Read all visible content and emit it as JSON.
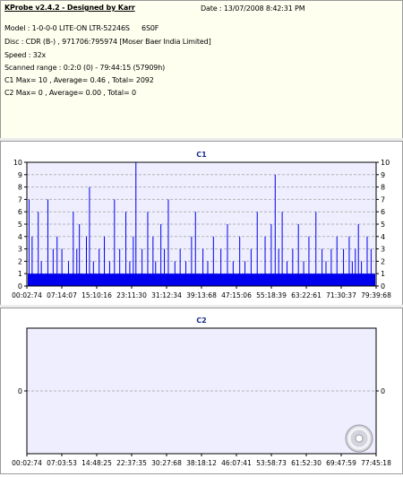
{
  "header": {
    "app_title": "KProbe v2.4.2 - Designed by Karr",
    "date": "Date : 13/07/2008 8:42:31 PM",
    "model": "Model : 1-0-0-0 LITE-ON LTR-52246S",
    "firmware": "6S0F",
    "disc": "Disc : CDR (B-) , 971706:795974 [Moser Baer India Limited]",
    "speed": "Speed : 32x",
    "scanned_range": "Scanned range : 0:2:0 (0) - 79:44:15 (57909h)",
    "c1_summary": "C1 Max= 10 , Average= 0.46 , Total= 2092",
    "c2_summary": "C2 Max= 0 , Average= 0.00 , Total= 0"
  },
  "colors": {
    "plot_bg": "#eeeeff",
    "bars": "#0000ee",
    "title": "#1a2a8a",
    "grid": "#b4b4b4"
  },
  "icons": {
    "disc": "cd-disc-icon"
  },
  "chart_data": [
    {
      "type": "bar",
      "title": "C1",
      "xlabel": "",
      "ylabel": "",
      "ylim": [
        0,
        10
      ],
      "y_ticks": [
        "0",
        "1",
        "2",
        "3",
        "4",
        "5",
        "6",
        "7",
        "8",
        "9",
        "10"
      ],
      "x_ticks": [
        "00:02:74",
        "07:14:07",
        "15:10:16",
        "23:11:30",
        "31:12:34",
        "39:13:68",
        "47:15:06",
        "55:18:39",
        "63:22:61",
        "71:30:37",
        "79:39:68"
      ],
      "grid": true,
      "x_range_minutes": [
        0.0,
        79.75
      ],
      "baseline_value": 1,
      "spikes": [
        {
          "t": 0.5,
          "v": 7
        },
        {
          "t": 1.2,
          "v": 4
        },
        {
          "t": 2.6,
          "v": 6
        },
        {
          "t": 3.3,
          "v": 2
        },
        {
          "t": 4.8,
          "v": 7
        },
        {
          "t": 6.0,
          "v": 3
        },
        {
          "t": 6.9,
          "v": 4
        },
        {
          "t": 8.0,
          "v": 3
        },
        {
          "t": 9.5,
          "v": 2
        },
        {
          "t": 10.6,
          "v": 6
        },
        {
          "t": 11.4,
          "v": 3
        },
        {
          "t": 12.0,
          "v": 5
        },
        {
          "t": 13.6,
          "v": 4
        },
        {
          "t": 14.3,
          "v": 8
        },
        {
          "t": 15.2,
          "v": 2
        },
        {
          "t": 16.5,
          "v": 3
        },
        {
          "t": 17.7,
          "v": 4
        },
        {
          "t": 18.9,
          "v": 2
        },
        {
          "t": 20.0,
          "v": 7
        },
        {
          "t": 21.2,
          "v": 3
        },
        {
          "t": 22.6,
          "v": 6
        },
        {
          "t": 23.5,
          "v": 2
        },
        {
          "t": 24.3,
          "v": 4
        },
        {
          "t": 24.9,
          "v": 10
        },
        {
          "t": 26.3,
          "v": 3
        },
        {
          "t": 27.6,
          "v": 6
        },
        {
          "t": 28.8,
          "v": 4
        },
        {
          "t": 29.4,
          "v": 2
        },
        {
          "t": 30.6,
          "v": 5
        },
        {
          "t": 31.4,
          "v": 3
        },
        {
          "t": 32.3,
          "v": 7
        },
        {
          "t": 33.8,
          "v": 2
        },
        {
          "t": 35.0,
          "v": 3
        },
        {
          "t": 36.3,
          "v": 2
        },
        {
          "t": 37.6,
          "v": 4
        },
        {
          "t": 38.5,
          "v": 6
        },
        {
          "t": 40.2,
          "v": 3
        },
        {
          "t": 41.3,
          "v": 2
        },
        {
          "t": 42.6,
          "v": 4
        },
        {
          "t": 44.3,
          "v": 3
        },
        {
          "t": 45.8,
          "v": 5
        },
        {
          "t": 47.1,
          "v": 2
        },
        {
          "t": 48.6,
          "v": 4
        },
        {
          "t": 49.8,
          "v": 2
        },
        {
          "t": 51.2,
          "v": 3
        },
        {
          "t": 52.6,
          "v": 6
        },
        {
          "t": 54.4,
          "v": 4
        },
        {
          "t": 55.8,
          "v": 5
        },
        {
          "t": 56.7,
          "v": 9
        },
        {
          "t": 57.5,
          "v": 3
        },
        {
          "t": 58.3,
          "v": 6
        },
        {
          "t": 59.4,
          "v": 2
        },
        {
          "t": 60.7,
          "v": 3
        },
        {
          "t": 62.0,
          "v": 5
        },
        {
          "t": 63.2,
          "v": 2
        },
        {
          "t": 64.4,
          "v": 4
        },
        {
          "t": 66.0,
          "v": 6
        },
        {
          "t": 67.4,
          "v": 3
        },
        {
          "t": 68.3,
          "v": 2
        },
        {
          "t": 69.5,
          "v": 3
        },
        {
          "t": 70.8,
          "v": 4
        },
        {
          "t": 72.3,
          "v": 3
        },
        {
          "t": 73.6,
          "v": 4
        },
        {
          "t": 74.3,
          "v": 2
        },
        {
          "t": 75.0,
          "v": 3
        },
        {
          "t": 75.7,
          "v": 5
        },
        {
          "t": 76.4,
          "v": 2
        },
        {
          "t": 77.7,
          "v": 4
        },
        {
          "t": 78.6,
          "v": 3
        }
      ]
    },
    {
      "type": "bar",
      "title": "C2",
      "xlabel": "",
      "ylabel": "",
      "ylim": [
        -1,
        1
      ],
      "y_ticks": [
        "0"
      ],
      "x_ticks": [
        "00:02:74",
        "07:03:53",
        "14:48:25",
        "22:37:35",
        "30:27:68",
        "38:18:12",
        "46:07:41",
        "53:58:73",
        "61:52:30",
        "69:47:59",
        "77:45:18"
      ],
      "grid": true,
      "values": [],
      "total": 0
    }
  ]
}
